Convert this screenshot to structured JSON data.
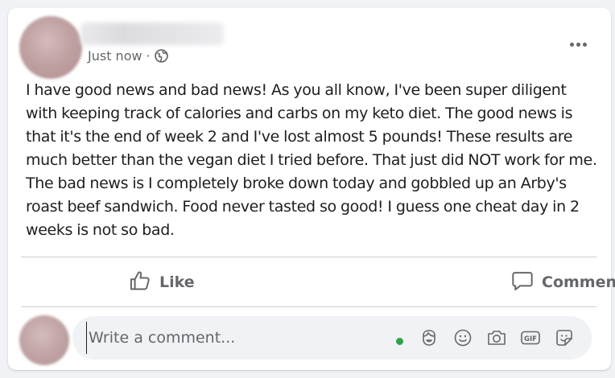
{
  "post": {
    "time_label": "Just now",
    "separator": "·",
    "privacy_icon": "public-globe-icon",
    "more_icon": "more-options-icon",
    "body": "I have good news and bad news! As you all know, I've been super diligent with keeping track of calories and carbs on my keto diet. The good news is that it's the end of week 2 and I've lost almost 5 pounds! These results are much better than the vegan diet I tried before. That just did NOT work for me. The bad news is I completely broke down today and gobbled up an Arby's roast beef sandwich. Food never tasted so good! I guess one cheat day in 2 weeks is not so bad."
  },
  "actions": {
    "like_label": "Like",
    "comment_label": "Comment"
  },
  "composer": {
    "placeholder": "Write a comment...",
    "online_color": "#31a24c",
    "tools": [
      "avatar-sticker-icon",
      "emoji-icon",
      "camera-icon",
      "gif-icon",
      "sticker-icon"
    ]
  },
  "colors": {
    "text": "#1c1e21",
    "secondary_text": "#65676b",
    "background": "#f0f2f5"
  }
}
